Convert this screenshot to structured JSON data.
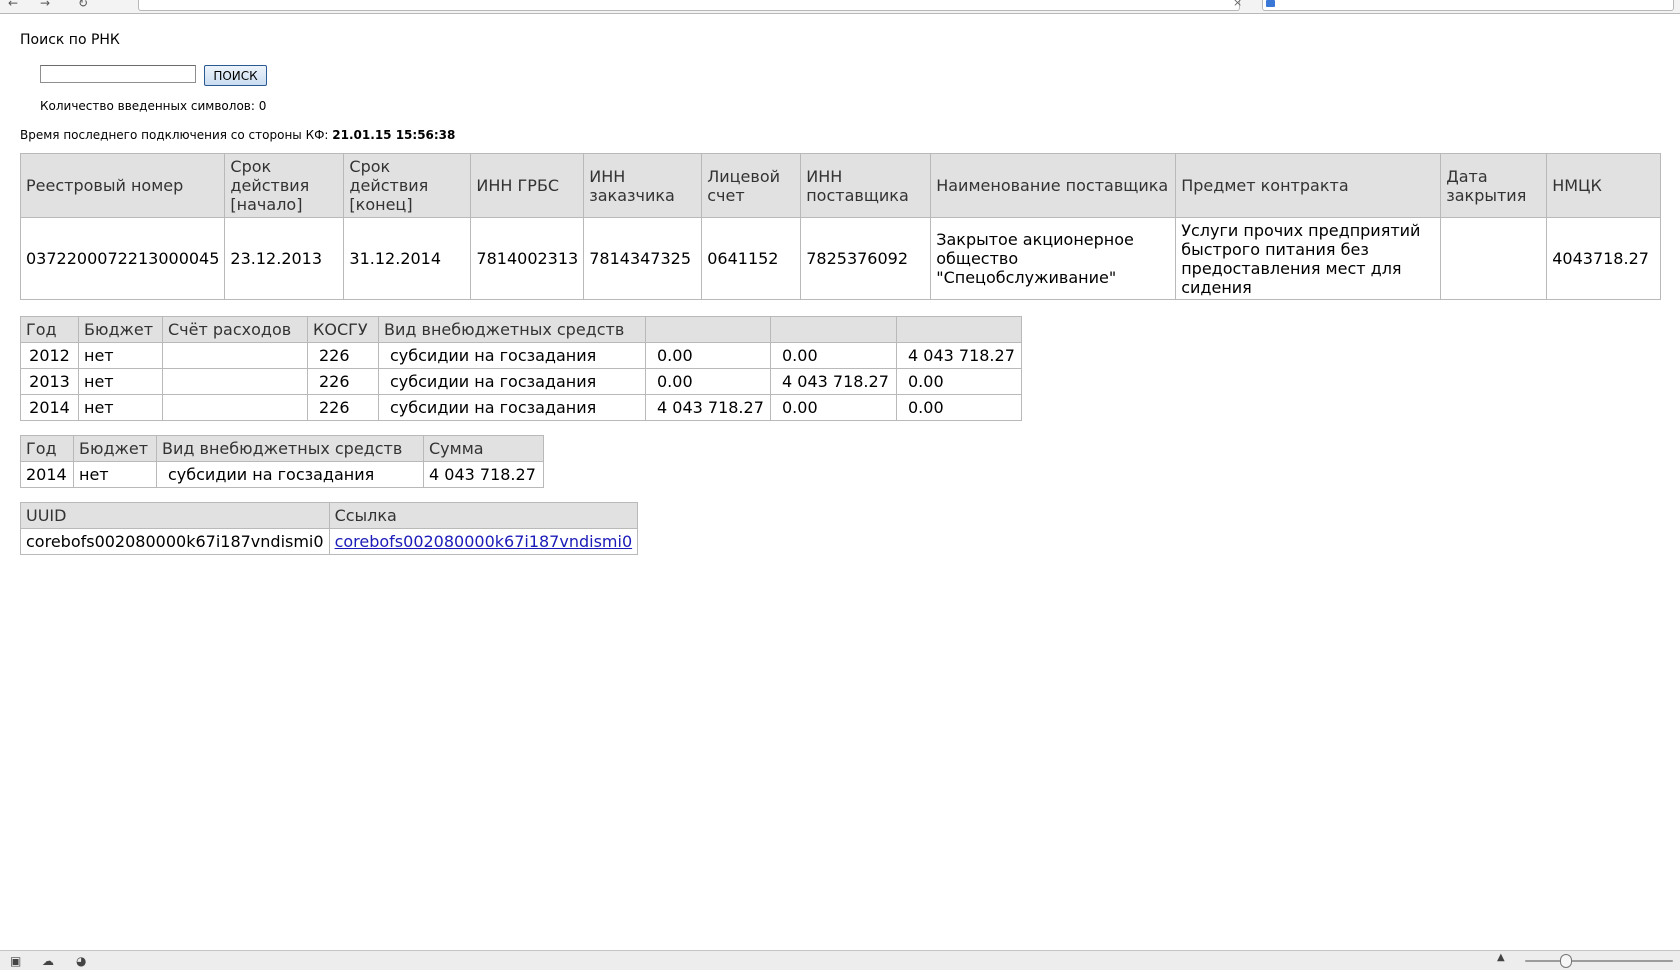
{
  "search": {
    "title": "Поиск по РНК",
    "input_value": "",
    "button_label": "ПОИСК",
    "char_count_text": "Количество введенных символов: 0"
  },
  "last_connection": {
    "label": "Время последнего подключения со стороны КФ:",
    "value": "21.01.15 15:56:38"
  },
  "contract_table": {
    "headers": [
      "Реестровый номер",
      "Срок действия [начало]",
      "Срок действия [конец]",
      "ИНН ГРБС",
      "ИНН заказчика",
      "Лицевой счет",
      "ИНН поставщика",
      "Наименование поставщика",
      "Предмет контракта",
      "Дата закрытия",
      "НМЦК"
    ],
    "row": [
      "0372200072213000045",
      "23.12.2013",
      "31.12.2014",
      "7814002313",
      "7814347325",
      "0641152",
      "7825376092",
      "Закрытое акционерное общество \"Спецобслуживание\"",
      "Услуги прочих предприятий быстрого питания без предоставления мест для сидения",
      "",
      "4043718.27"
    ]
  },
  "years_table": {
    "headers": [
      "Год",
      "Бюджет",
      "Счёт расходов",
      "КОСГУ",
      "Вид внебюджетных средств",
      "",
      "",
      ""
    ],
    "rows": [
      [
        "2012",
        "нет",
        "",
        "226",
        "субсидии на госзадания",
        "0.00",
        "0.00",
        "4 043 718.27"
      ],
      [
        "2013",
        "нет",
        "",
        "226",
        "субсидии на госзадания",
        "0.00",
        "4 043 718.27",
        "0.00"
      ],
      [
        "2014",
        "нет",
        "",
        "226",
        "субсидии на госзадания",
        "4 043 718.27",
        "0.00",
        "0.00"
      ]
    ]
  },
  "sum_table": {
    "headers": [
      "Год",
      "Бюджет",
      "Вид внебюджетных средств",
      "Сумма"
    ],
    "row": [
      "2014",
      "нет",
      "субсидии на госзадания",
      "4 043 718.27"
    ]
  },
  "uuid_table": {
    "headers": [
      "UUID",
      "Ссылка"
    ],
    "row": [
      "corebofs002080000k67i187vndismi0",
      "corebofs002080000k67i187vndismi0"
    ]
  },
  "icons": {
    "status_left": [
      "console-icon",
      "cloud-icon",
      "gauge-icon"
    ],
    "zoom": "zoom-slider"
  }
}
